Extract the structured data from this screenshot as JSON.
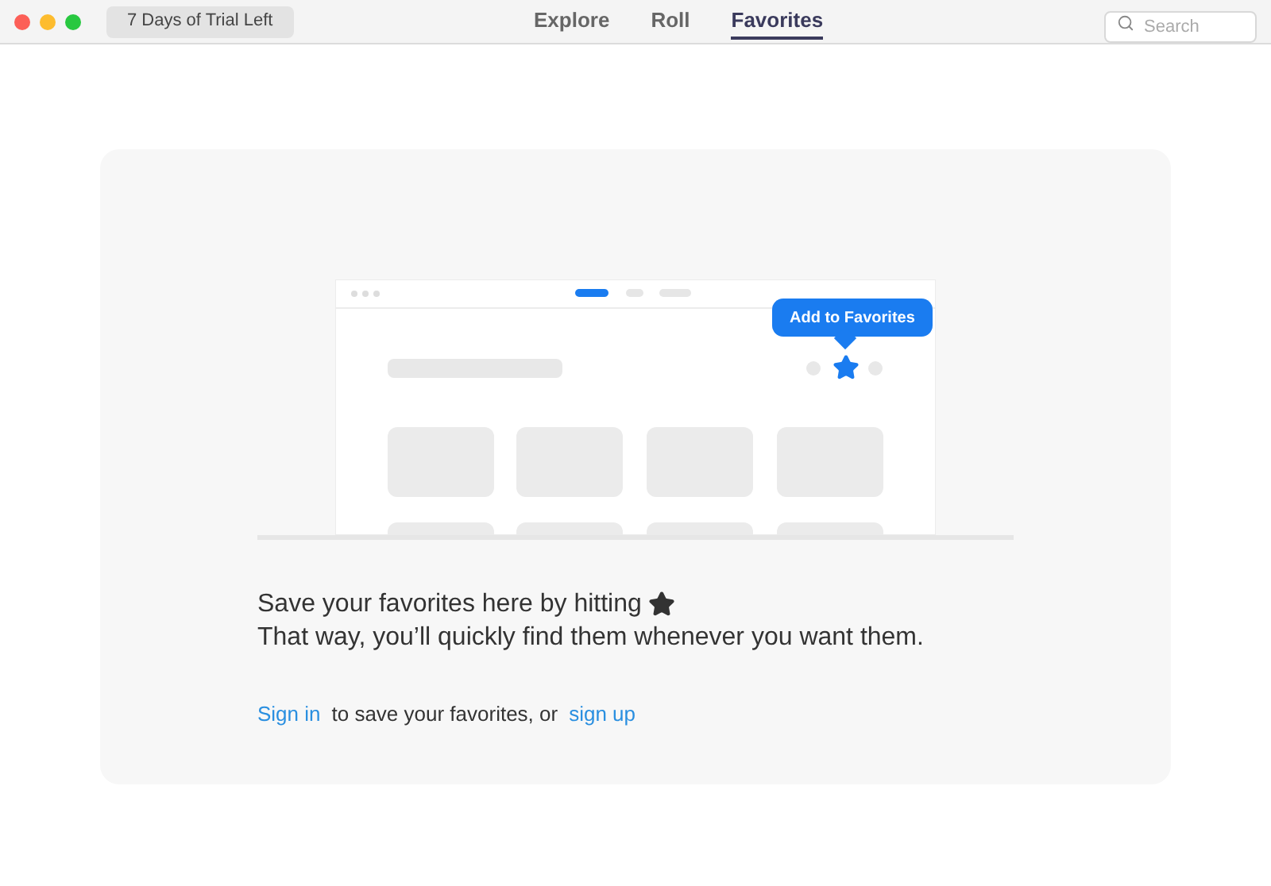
{
  "window": {
    "trial_badge": "7 Days of Trial Left"
  },
  "tabs": [
    {
      "label": "Explore",
      "selected": false
    },
    {
      "label": "Roll",
      "selected": false
    },
    {
      "label": "Favorites",
      "selected": true
    }
  ],
  "search": {
    "placeholder": "Search"
  },
  "empty_state": {
    "tooltip": "Add to Favorites",
    "line_1": "Save your favorites here by hitting",
    "line_2": "That way, you’ll quickly find them whenever you want them.",
    "sign_in": "Sign in",
    "middle": "to save your favorites, or",
    "sign_up": "sign up"
  }
}
